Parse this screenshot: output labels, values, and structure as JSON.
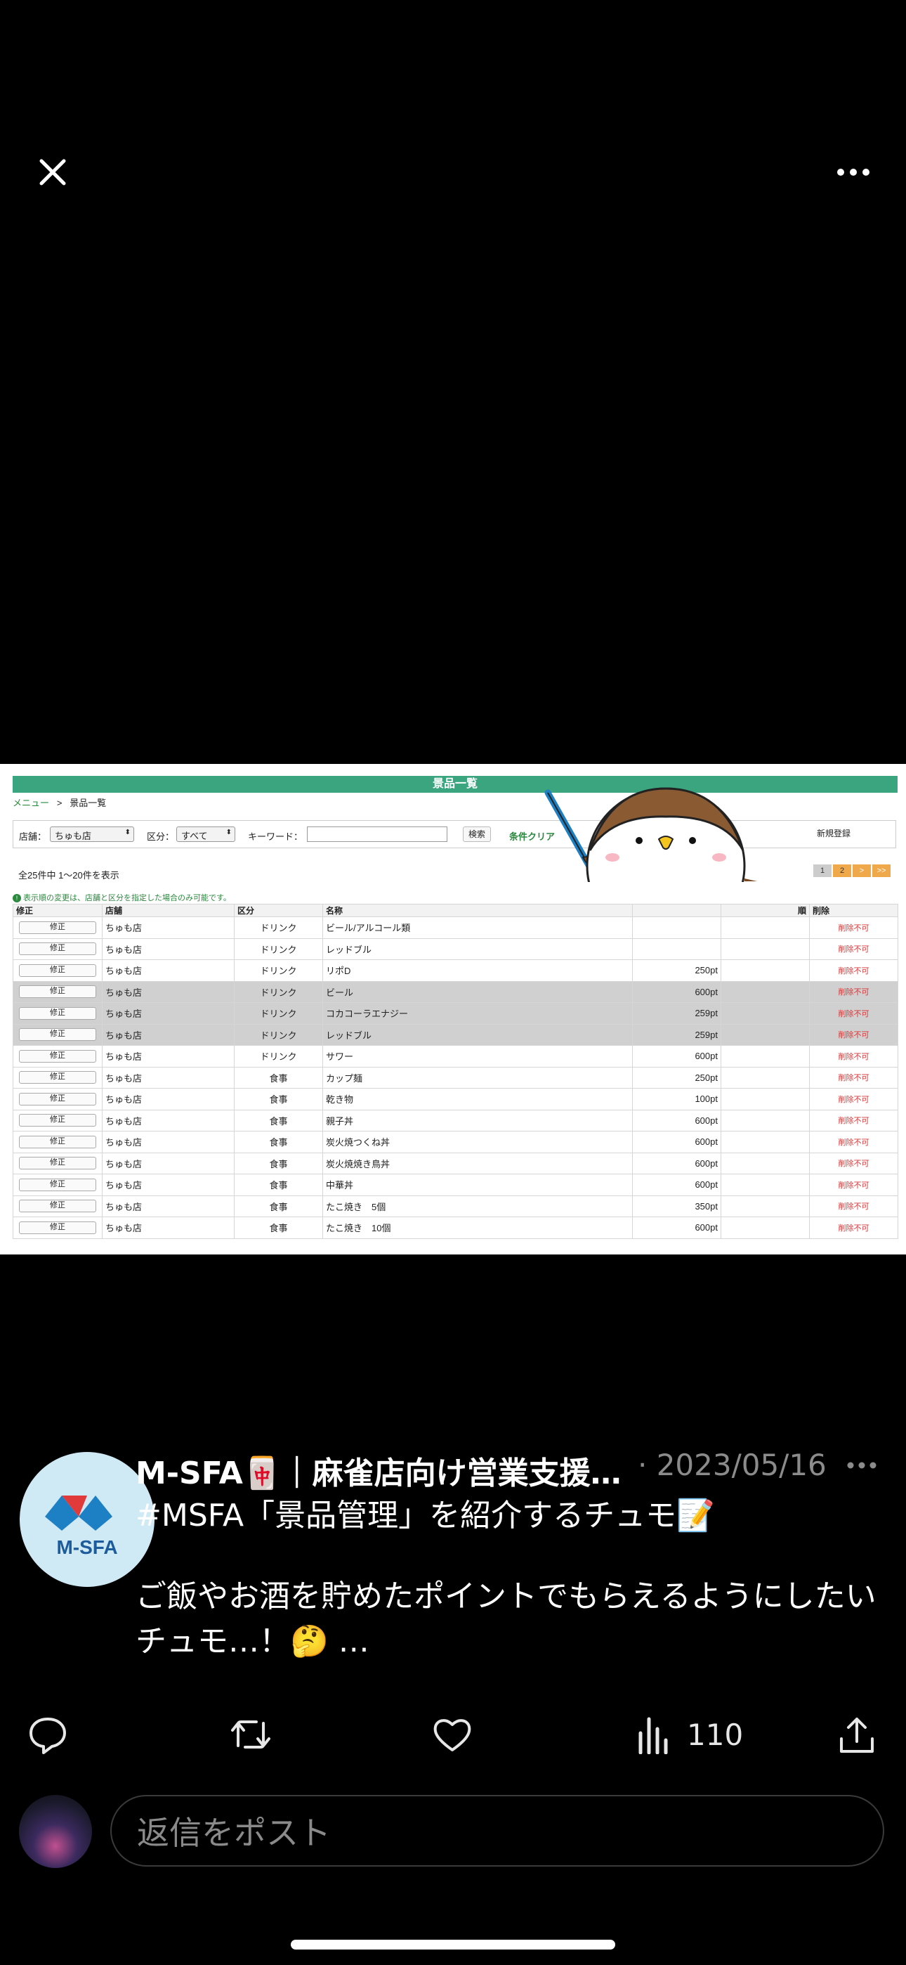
{
  "media": {
    "app_title": "景品一覧",
    "breadcrumb": {
      "menu": "メニュー",
      "sep": ">",
      "current": "景品一覧"
    },
    "filters": {
      "store_label": "店舗：",
      "store_value": "ちゅも店",
      "category_label": "区分：",
      "category_value": "すべて",
      "keyword_label": "キーワード：",
      "search_button": "検索",
      "clear_link": "条件クリア",
      "new_button": "新規登録"
    },
    "count_text": "全25件中 1〜20件を表示",
    "pager": [
      "1",
      "2",
      ">",
      ">>"
    ],
    "note": "表示順の変更は、店舗と区分を指定した場合のみ可能です。",
    "columns": {
      "edit": "修正",
      "store": "店舗",
      "category": "区分",
      "name": "名称",
      "order": "順",
      "delete": "削除"
    },
    "edit_label": "修正",
    "delete_label": "削除不可",
    "rows": [
      {
        "store": "ちゅも店",
        "category": "ドリンク",
        "name": "ビール/アルコール類",
        "points": "",
        "hl": false
      },
      {
        "store": "ちゅも店",
        "category": "ドリンク",
        "name": "レッドブル",
        "points": "",
        "hl": false
      },
      {
        "store": "ちゅも店",
        "category": "ドリンク",
        "name": "リポD",
        "points": "250pt",
        "hl": false
      },
      {
        "store": "ちゅも店",
        "category": "ドリンク",
        "name": "ビール",
        "points": "600pt",
        "hl": true
      },
      {
        "store": "ちゅも店",
        "category": "ドリンク",
        "name": "コカコーラエナジー",
        "points": "259pt",
        "hl": true
      },
      {
        "store": "ちゅも店",
        "category": "ドリンク",
        "name": "レッドブル",
        "points": "259pt",
        "hl": true
      },
      {
        "store": "ちゅも店",
        "category": "ドリンク",
        "name": "サワー",
        "points": "600pt",
        "hl": false
      },
      {
        "store": "ちゅも店",
        "category": "食事",
        "name": "カップ麺",
        "points": "250pt",
        "hl": false
      },
      {
        "store": "ちゅも店",
        "category": "食事",
        "name": "乾き物",
        "points": "100pt",
        "hl": false
      },
      {
        "store": "ちゅも店",
        "category": "食事",
        "name": "親子丼",
        "points": "600pt",
        "hl": false
      },
      {
        "store": "ちゅも店",
        "category": "食事",
        "name": "炭火焼つくね丼",
        "points": "600pt",
        "hl": false
      },
      {
        "store": "ちゅも店",
        "category": "食事",
        "name": "炭火焼焼き鳥丼",
        "points": "600pt",
        "hl": false
      },
      {
        "store": "ちゅも店",
        "category": "食事",
        "name": "中華丼",
        "points": "600pt",
        "hl": false
      },
      {
        "store": "ちゅも店",
        "category": "食事",
        "name": "たこ焼き　5個",
        "points": "350pt",
        "hl": false
      },
      {
        "store": "ちゅも店",
        "category": "食事",
        "name": "たこ焼き　10個",
        "points": "600pt",
        "hl": false
      }
    ]
  },
  "post": {
    "avatar_text": "M-SFA",
    "author": "M-SFA🀄️｜麻雀店向け営業支援…",
    "date": "· 2023/05/16",
    "body_line1": "#MSFA「景品管理」を紹介するチュモ📝",
    "body_line2": "ご飯やお酒を貯めたポイントでもらえるようにしたいチュモ…！🤔 …",
    "views": "110"
  },
  "reply": {
    "placeholder": "返信をポスト"
  },
  "colors": {
    "accent": "#3aa57f",
    "danger": "#d33333",
    "pager_active": "#f0a94a"
  }
}
